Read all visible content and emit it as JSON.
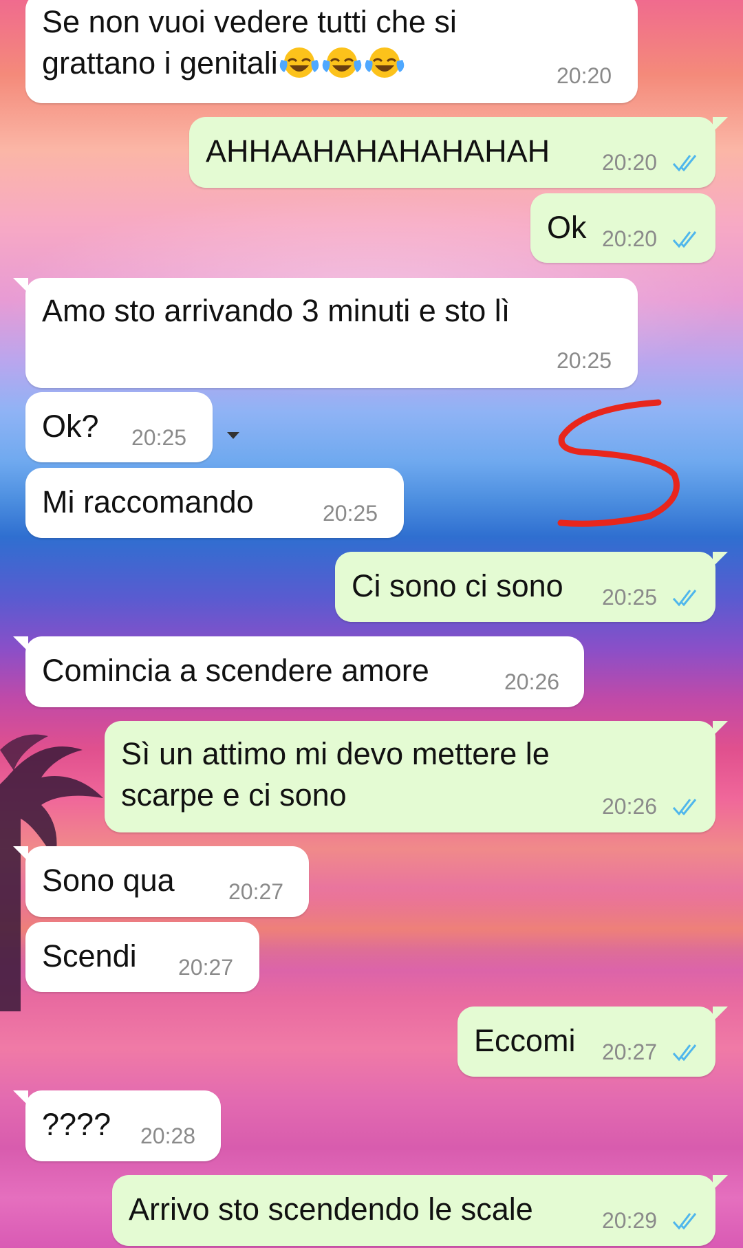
{
  "messages": [
    {
      "side": "in",
      "lines": [
        "Se non vuoi vedere tutti che si",
        "grattano i genitali"
      ],
      "emoji": "face-with-tears-of-joy",
      "emoji_count": 3,
      "time": "20:20"
    },
    {
      "side": "out",
      "lines": [
        "AHHAAHAHAHAHAHAH"
      ],
      "time": "20:20",
      "status": "read"
    },
    {
      "side": "out",
      "lines": [
        "Ok"
      ],
      "time": "20:20",
      "status": "read"
    },
    {
      "side": "in",
      "lines": [
        "Amo sto arrivando 3 minuti e sto lì"
      ],
      "time": "20:25"
    },
    {
      "side": "in",
      "lines": [
        "Ok?"
      ],
      "time": "20:25"
    },
    {
      "side": "in",
      "lines": [
        "Mi raccomando"
      ],
      "time": "20:25"
    },
    {
      "side": "out",
      "lines": [
        "Ci sono ci sono"
      ],
      "time": "20:25",
      "status": "read"
    },
    {
      "side": "in",
      "lines": [
        "Comincia a scendere amore"
      ],
      "time": "20:26"
    },
    {
      "side": "out",
      "lines": [
        "Sì un attimo mi devo mettere le",
        "scarpe e ci sono"
      ],
      "time": "20:26",
      "status": "read"
    },
    {
      "side": "in",
      "lines": [
        "Sono qua"
      ],
      "time": "20:27"
    },
    {
      "side": "in",
      "lines": [
        "Scendi"
      ],
      "time": "20:27"
    },
    {
      "side": "out",
      "lines": [
        "Eccomi"
      ],
      "time": "20:27",
      "status": "read"
    },
    {
      "side": "in",
      "lines": [
        "????"
      ],
      "time": "20:28"
    },
    {
      "side": "out",
      "lines": [
        "Arrivo sto scendendo le scale"
      ],
      "time": "20:29",
      "status": "read"
    }
  ],
  "icons": {
    "read_ticks": "double-check-icon",
    "message_menu": "chevron-down-icon"
  },
  "colors": {
    "incoming_bubble": "#ffffff",
    "outgoing_bubble": "#e4fbd3",
    "read_ticks": "#4fb6ec",
    "doodle": "#e8261c",
    "timestamp": "#8a8a8a"
  }
}
